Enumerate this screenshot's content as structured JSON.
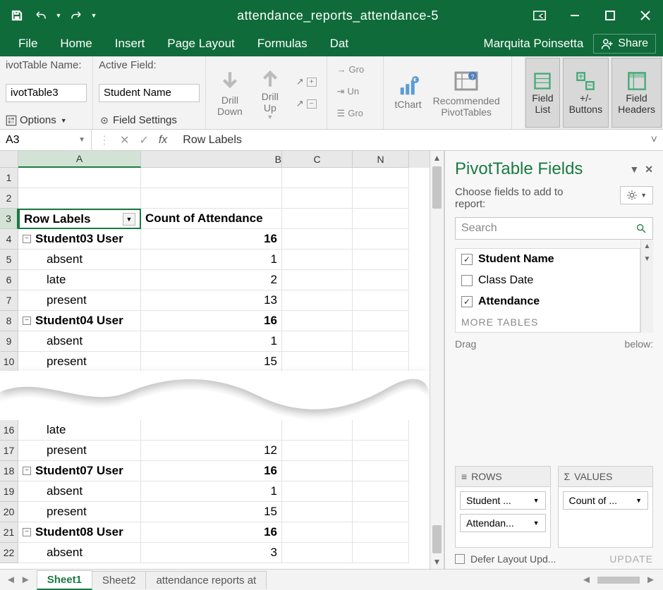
{
  "title": "attendance_reports_attendance-5",
  "user_name": "Marquita Poinsetta",
  "share_label": "Share",
  "tabs": [
    "File",
    "Home",
    "Insert",
    "Page Layout",
    "Formulas",
    "Dat"
  ],
  "ribbon": {
    "pt_name_label": "ivotTable Name:",
    "pt_name_value": "ivotTable3",
    "options_label": "Options",
    "active_field_label": "Active Field:",
    "active_field_value": "Student Name",
    "field_settings_label": "Field Settings",
    "drill_down": "Drill\nDown",
    "drill_up": "Drill\nUp",
    "gro1": "Gro",
    "ung": "Un",
    "gro2": "Gro",
    "chart_label": "tChart",
    "rec_pivot": "Recommended\nPivotTables",
    "field_list": "Field\nList",
    "pm_buttons": "+/-\nButtons",
    "field_headers": "Field\nHeaders"
  },
  "namebox": "A3",
  "formula_value": "Row Labels",
  "columns": [
    "A",
    "B",
    "C",
    "N"
  ],
  "pivot": {
    "header_a": "Row Labels",
    "header_b": "Count of Attendance",
    "rows_top": [
      {
        "rn": 1,
        "a": "",
        "b": ""
      },
      {
        "rn": 2,
        "a": "",
        "b": ""
      },
      {
        "rn": 3,
        "type": "header"
      },
      {
        "rn": 4,
        "type": "group",
        "a": "Student03 User",
        "b": "16"
      },
      {
        "rn": 5,
        "type": "child",
        "a": "absent",
        "b": "1"
      },
      {
        "rn": 6,
        "type": "child",
        "a": "late",
        "b": "2"
      },
      {
        "rn": 7,
        "type": "child",
        "a": "present",
        "b": "13"
      },
      {
        "rn": 8,
        "type": "group",
        "a": "Student04 User",
        "b": "16"
      },
      {
        "rn": 9,
        "type": "child",
        "a": "absent",
        "b": "1"
      },
      {
        "rn": 10,
        "type": "child",
        "a": "present",
        "b": "15"
      }
    ],
    "rows_bottom": [
      {
        "rn": 16,
        "type": "child",
        "a": "late",
        "b": ""
      },
      {
        "rn": 17,
        "type": "child",
        "a": "present",
        "b": "12"
      },
      {
        "rn": 18,
        "type": "group",
        "a": "Student07 User",
        "b": "16"
      },
      {
        "rn": 19,
        "type": "child",
        "a": "absent",
        "b": "1"
      },
      {
        "rn": 20,
        "type": "child",
        "a": "present",
        "b": "15"
      },
      {
        "rn": 21,
        "type": "group",
        "a": "Student08 User",
        "b": "16"
      },
      {
        "rn": 22,
        "type": "child",
        "a": "absent",
        "b": "3"
      }
    ]
  },
  "side": {
    "title": "PivotTable Fields",
    "subtitle": "Choose fields to add to report:",
    "search_placeholder": "Search",
    "fields": [
      {
        "label": "Student Name",
        "checked": true
      },
      {
        "label": "Class Date",
        "checked": false
      },
      {
        "label": "Attendance",
        "checked": true
      }
    ],
    "more_tables": "MORE TABLES",
    "drag_hint_left": "Drag",
    "drag_hint_right": "below:",
    "rows_head": "ROWS",
    "values_head": "VALUES",
    "rows_pills": [
      "Student ...",
      "Attendan..."
    ],
    "values_pills": [
      "Count of ..."
    ],
    "defer_label": "Defer Layout Upd...",
    "update_label": "UPDATE"
  },
  "sheets": {
    "active": "Sheet1",
    "tabs": [
      "Sheet1",
      "Sheet2",
      "attendance reports at"
    ]
  }
}
